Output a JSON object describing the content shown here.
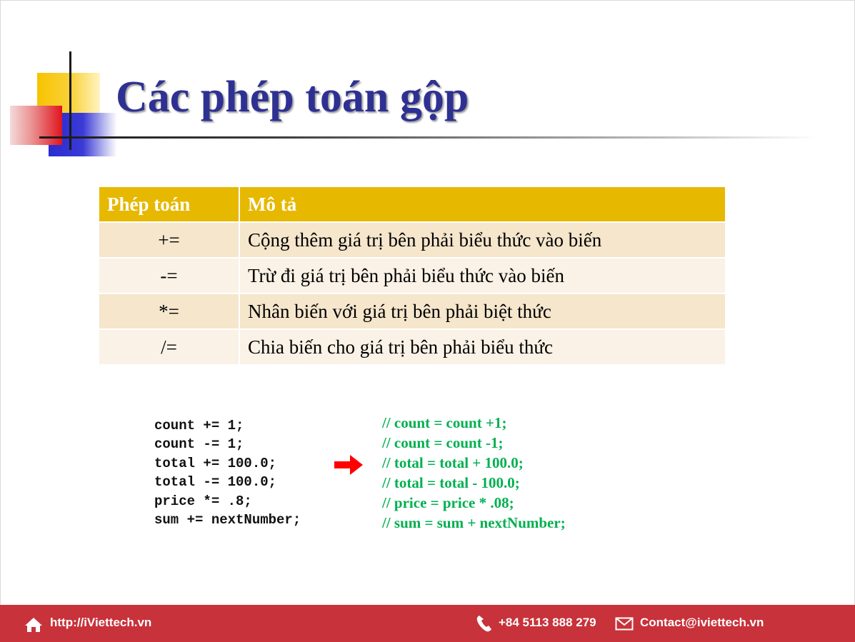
{
  "slide": {
    "title": "Các phép toán gộp"
  },
  "table": {
    "headers": [
      "Phép toán",
      "Mô tả"
    ],
    "rows": [
      {
        "op": "+=",
        "desc": "Cộng thêm giá trị bên phải biểu thức vào biến"
      },
      {
        "op": "-=",
        "desc": "Trừ đi giá trị bên phải biểu thức vào biến"
      },
      {
        "op": "*=",
        "desc": "Nhân biến với giá trị bên phải biệt thức"
      },
      {
        "op": "/=",
        "desc": "Chia biến cho giá trị bên phải biểu thức"
      }
    ]
  },
  "code": [
    "count += 1;",
    "count -= 1;",
    "total += 100.0;",
    "total -= 100.0;",
    "price *= .8;",
    "sum += nextNumber;"
  ],
  "comments": [
    "// count = count +1;",
    "// count = count -1;",
    "// total = total + 100.0;",
    "// total = total - 100.0;",
    "// price = price * .08;",
    "// sum = sum + nextNumber;"
  ],
  "footer": {
    "website": "http://iViettech.vn",
    "phone": "+84 5113 888 279",
    "email": "Contact@iviettech.vn"
  },
  "colors": {
    "title": "#2e3192",
    "header_bg": "#e6b800",
    "comment": "#00b050",
    "arrow": "#ff0000",
    "footer_bg": "#c8323a"
  },
  "icons": {
    "footer_website": "home-icon",
    "footer_phone": "phone-icon",
    "footer_email": "envelope-icon",
    "arrow": "right-arrow-icon"
  }
}
